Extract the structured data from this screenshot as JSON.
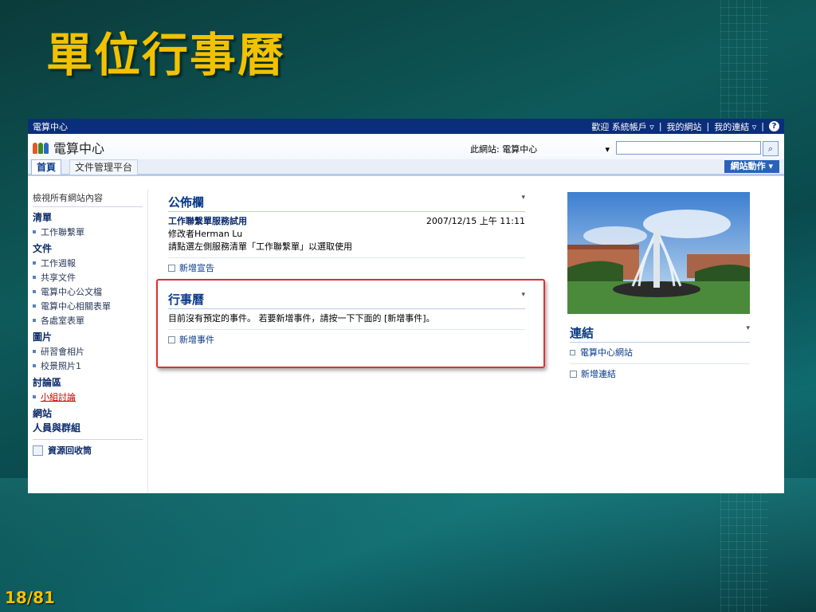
{
  "slide": {
    "title": "單位行事曆",
    "page_number": "18/81"
  },
  "topbar": {
    "site_name": "電算中心",
    "welcome": "歡迎 系統帳戶 ▿",
    "my_site": "我的網站",
    "my_links": "我的連結 ▿",
    "sep": "|"
  },
  "header": {
    "site_title": "電算中心",
    "scope_label": "此網站: 電算中心",
    "scope_arrow": "▾",
    "search_value": "",
    "search_button": "⌕"
  },
  "nav": {
    "tabs": [
      {
        "label": "首頁"
      },
      {
        "label": "文件管理平台"
      }
    ],
    "site_actions": "網站動作 ▾"
  },
  "leftnav": {
    "view_all": "檢視所有網站內容",
    "sections": [
      {
        "header": "清單",
        "items": [
          "工作聯繫單"
        ]
      },
      {
        "header": "文件",
        "items": [
          "工作週報",
          "共享文件",
          "電算中心公文檔",
          "電算中心相關表單",
          "各處室表單"
        ]
      },
      {
        "header": "圖片",
        "items": [
          "研習會相片",
          "校景照片1"
        ]
      },
      {
        "header": "討論區",
        "items": [
          "小組討論"
        ]
      }
    ],
    "site_header": "網站",
    "people_header": "人員與群組",
    "recycle_bin": "資源回收筒"
  },
  "announcements": {
    "title": "公佈欄",
    "dropdown": "▾",
    "item_title": "工作聯繫單服務試用",
    "item_date": "2007/12/15 上午 11:11",
    "modified_by": "修改者Herman Lu",
    "body": "請點選左側服務清單「工作聯繫單」以選取使用",
    "add_link": "新增宣告"
  },
  "calendar": {
    "title": "行事曆",
    "dropdown": "▾",
    "empty_message": "目前沒有預定的事件。 若要新增事件，請按一下下面的 [新增事件]。",
    "add_link": "新增事件"
  },
  "links": {
    "title": "連結",
    "dropdown": "▾",
    "items": [
      "電算中心網站"
    ],
    "add_link": "新增連結"
  },
  "colors": {
    "slide_title": "#f2c200",
    "topbar": "#0a2e7a",
    "highlight": "#e03030"
  }
}
